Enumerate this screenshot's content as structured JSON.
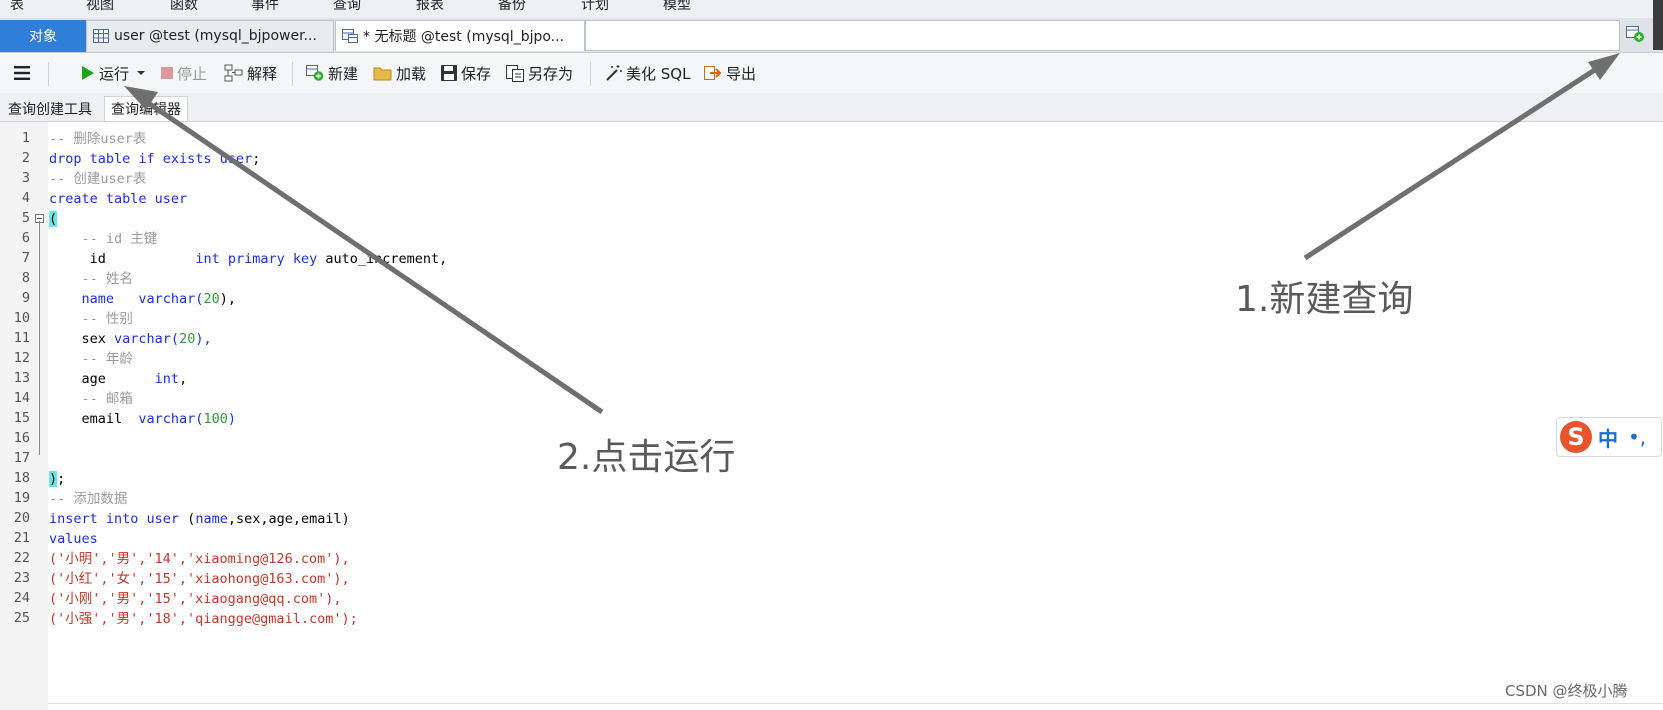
{
  "menu": {
    "items": [
      "表",
      "视图",
      "函数",
      "事件",
      "查询",
      "报表",
      "备份",
      "计划",
      "模型"
    ]
  },
  "tabs": {
    "objects": "对象",
    "items": [
      {
        "label": "user @test (mysql_bjpower...",
        "icon": "table-icon"
      },
      {
        "label": "* 无标题 @test (mysql_bjpo...",
        "icon": "query-icon"
      }
    ]
  },
  "toolbar": {
    "run": "运行",
    "stop": "停止",
    "explain": "解释",
    "new": "新建",
    "load": "加载",
    "save": "保存",
    "save_as": "另存为",
    "beautify": "美化 SQL",
    "export": "导出"
  },
  "subtabs": [
    "查询创建工具",
    "查询编辑器"
  ],
  "code_lines": [
    "1",
    "2",
    "3",
    "4",
    "5",
    "6",
    "7",
    "8",
    "9",
    "10",
    "11",
    "12",
    "13",
    "14",
    "15",
    "16",
    "17",
    "18",
    "19",
    "20",
    "21",
    "22",
    "23",
    "24",
    "25"
  ],
  "code": {
    "l1": "-- 删除user表",
    "l2a": "drop table if exists user",
    "l2b": ";",
    "l3": "-- 创建user表",
    "l4": "create table user",
    "l5": "(",
    "l6": "    -- id 主键",
    "l7a": "     id           ",
    "l7b": "int primary key",
    "l7c": " auto_increment,",
    "l8": "    -- 姓名",
    "l9a": "    name   varchar(",
    "l9b": "20",
    "l9c": "),",
    "l10": "    -- 性别",
    "l11a": "    sex ",
    "l11b": "varchar(",
    "l11c": "20",
    "l11d": "),",
    "l12": "    -- 年龄",
    "l13a": "    age      ",
    "l13b": "int",
    "l13c": ",",
    "l14": "    -- 邮箱",
    "l15a": "    email  ",
    "l15b": "varchar(",
    "l15c": "100",
    "l15d": ")",
    "l18a": ")",
    "l18b": ";",
    "l19": "-- 添加数据",
    "l20a": "insert into user",
    "l20b": " (",
    "l20c": "name",
    "l20d": ",sex,age,email)",
    "l21": "values",
    "l22": "('小明','男','14','xiaoming@126.com'),",
    "l23": "('小红','女','15','xiaohong@163.com'),",
    "l24": "('小刚','男','15','xiaogang@qq.com'),",
    "l25": "('小强','男','18','qiangge@gmail.com');"
  },
  "annotations": {
    "new_query": "1.新建查询",
    "run": "2.点击运行"
  },
  "ime": {
    "logo": "S",
    "mode": "中",
    "punct": "•,"
  },
  "watermark": "CSDN @终极小腾",
  "colors": {
    "accent": "#2f7ed8",
    "keyword": "#1e2fd8",
    "comment": "#9c9c9c",
    "string": "#c0392b",
    "number": "#2e9a3a",
    "run_green": "#1aa61a"
  }
}
